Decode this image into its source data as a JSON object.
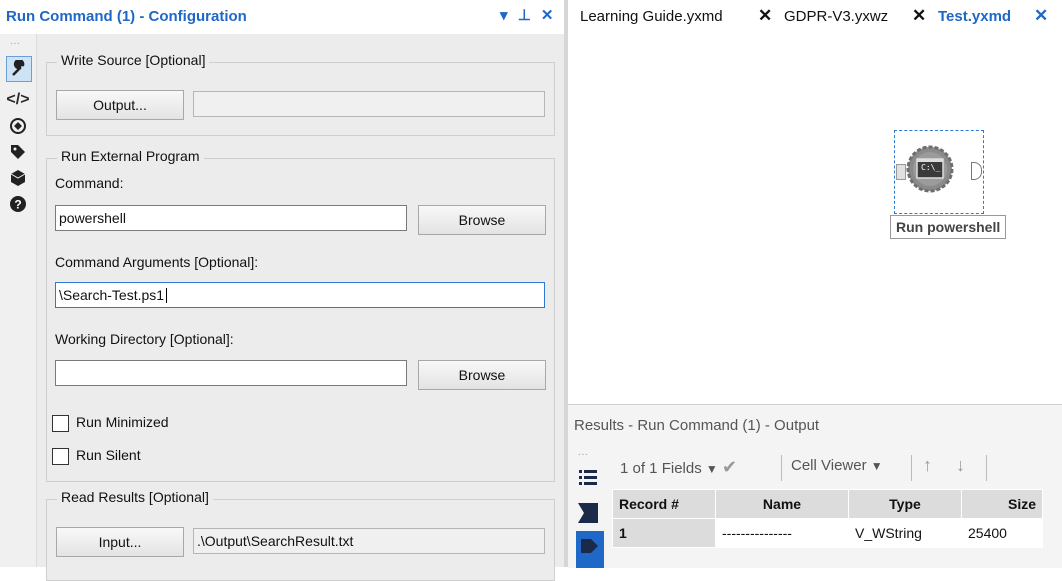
{
  "config_panel": {
    "title": "Run Command (1) - Configuration",
    "header_controls": "▾ ⊥ ✕",
    "write_source": {
      "legend": "Write Source [Optional]",
      "output_button": "Output...",
      "output_value": ""
    },
    "run_external": {
      "legend": "Run External Program",
      "command_label": "Command:",
      "command_value": "powershell",
      "browse_button": "Browse",
      "args_label": "Command Arguments [Optional]:",
      "args_value": "\\Search-Test.ps1",
      "workdir_label": "Working Directory [Optional]:",
      "workdir_value": "",
      "browse_button_2": "Browse",
      "run_minimized": "Run Minimized",
      "run_silent": "Run Silent"
    },
    "read_results": {
      "legend": "Read Results [Optional]",
      "input_button": "Input...",
      "input_value": ".\\Output\\SearchResult.txt"
    },
    "toolbar_icons": [
      "wrench-icon",
      "code-icon",
      "compass-icon",
      "tag-icon",
      "cube-icon",
      "help-icon"
    ]
  },
  "tabs": [
    {
      "label": "Learning Guide.yxmd",
      "active": false
    },
    {
      "label": "GDPR-V3.yxwz",
      "active": false
    },
    {
      "label": "Test.yxmd",
      "active": true
    }
  ],
  "canvas": {
    "tool_icon_text": "C:\\_",
    "tool_label": "Run powershell"
  },
  "results": {
    "title": "Results - Run Command (1) - Output",
    "fields_text": "1 of 1 Fields",
    "viewer_text": "Cell Viewer",
    "columns": [
      "Record #",
      "Name",
      "Type",
      "Size"
    ],
    "rows": [
      [
        "1",
        "---------------",
        "V_WString",
        "25400"
      ]
    ]
  },
  "colors": {
    "accent": "#1f68c7",
    "panel": "#ececec"
  }
}
